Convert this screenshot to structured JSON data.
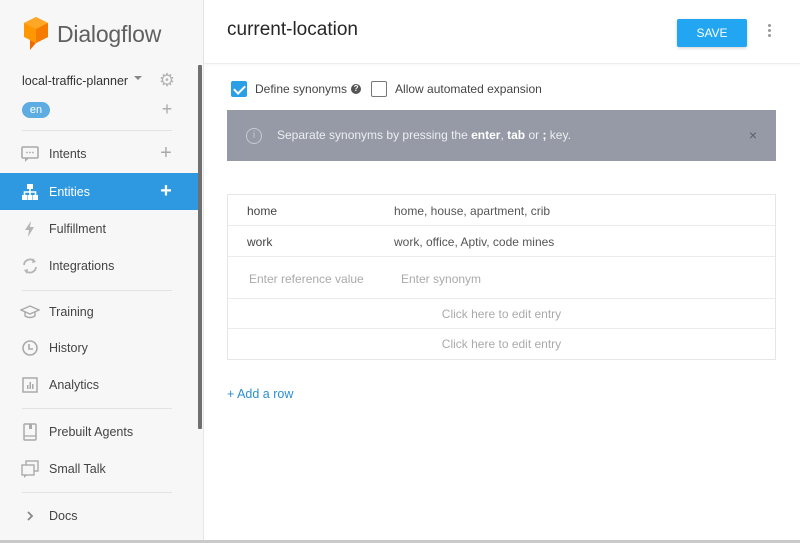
{
  "app": {
    "name": "Dialogflow",
    "brand_color": "#f57c00",
    "accent_color": "#2e98e0"
  },
  "agent": {
    "name": "local-traffic-planner",
    "language": "en"
  },
  "sidebar": {
    "items": [
      {
        "label": "Intents",
        "icon": "chat-icon",
        "has_add": true,
        "active": false
      },
      {
        "label": "Entities",
        "icon": "entities-icon",
        "has_add": true,
        "active": true
      },
      {
        "label": "Fulfillment",
        "icon": "bolt-icon",
        "has_add": false,
        "active": false
      },
      {
        "label": "Integrations",
        "icon": "sync-icon",
        "has_add": false,
        "active": false
      },
      {
        "label": "Training",
        "icon": "graduation-cap-icon",
        "has_add": false,
        "active": false
      },
      {
        "label": "History",
        "icon": "clock-icon",
        "has_add": false,
        "active": false
      },
      {
        "label": "Analytics",
        "icon": "bar-chart-icon",
        "has_add": false,
        "active": false
      },
      {
        "label": "Prebuilt Agents",
        "icon": "book-icon",
        "has_add": false,
        "active": false
      },
      {
        "label": "Small Talk",
        "icon": "chat-bubbles-icon",
        "has_add": false,
        "active": false
      },
      {
        "label": "Docs",
        "icon": "chevron-right-icon",
        "has_add": false,
        "active": false
      }
    ],
    "add_symbol": "+"
  },
  "header": {
    "title": "current-location",
    "save_label": "SAVE"
  },
  "options": {
    "define_synonyms": {
      "label": "Define synonyms",
      "checked": true,
      "help": "?"
    },
    "allow_expansion": {
      "label": "Allow automated expansion",
      "checked": false
    }
  },
  "info_bar": {
    "text_before": "Separate synonyms by pressing the ",
    "key1": "enter",
    "sep": ", ",
    "key2": "tab",
    "text_mid": " or ",
    "key3": ";",
    "text_after": " key.",
    "close": "×"
  },
  "entries": [
    {
      "reference": "home",
      "synonyms": "home, house, apartment, crib"
    },
    {
      "reference": "work",
      "synonyms": "work, office, Aptiv, code mines"
    }
  ],
  "new_entry": {
    "reference_placeholder": "Enter reference value",
    "synonym_placeholder": "Enter synonym"
  },
  "edit_rows": [
    "Click here to edit entry",
    "Click here to edit entry"
  ],
  "add_row_label": "+ Add a row"
}
